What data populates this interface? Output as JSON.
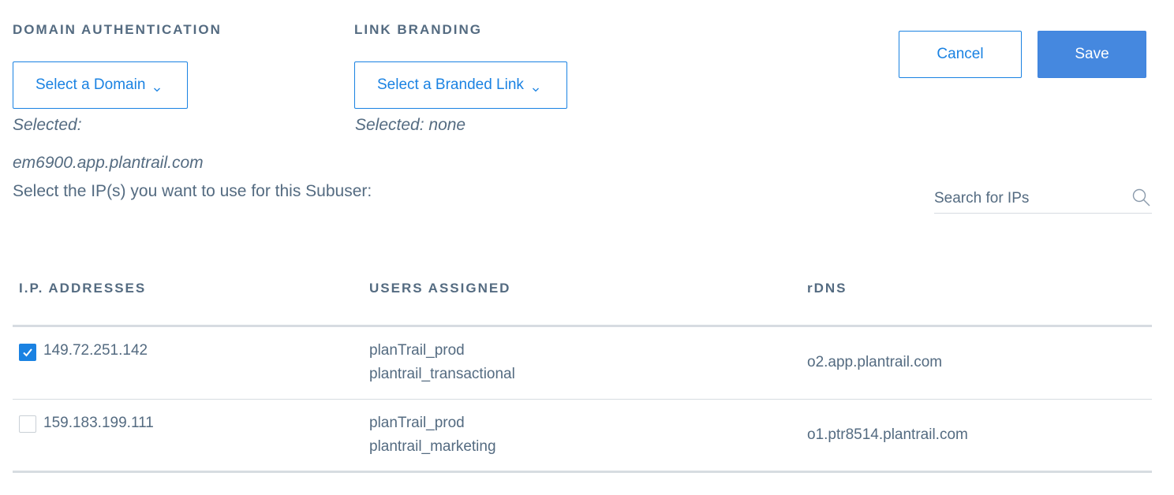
{
  "domain_auth": {
    "label": "DOMAIN AUTHENTICATION",
    "dropdown_label": "Select a Domain",
    "selected_label": "Selected:",
    "selected_value": "em6900.app.plantrail.com"
  },
  "link_branding": {
    "label": "LINK BRANDING",
    "dropdown_label": "Select a Branded Link",
    "selected_text": "Selected: none"
  },
  "actions": {
    "cancel_label": "Cancel",
    "save_label": "Save"
  },
  "ip_select": {
    "prompt": "Select the IP(s) you want to use for this Subuser:",
    "search_placeholder": "Search for IPs"
  },
  "table": {
    "headers": [
      "I.P. ADDRESSES",
      "USERS ASSIGNED",
      "rDNS"
    ],
    "rows": [
      {
        "ip": "149.72.251.142",
        "checked": true,
        "users": [
          "planTrail_prod",
          "plantrail_transactional"
        ],
        "rdns": "o2.app.plantrail.com"
      },
      {
        "ip": "159.183.199.111",
        "checked": false,
        "users": [
          "planTrail_prod",
          "plantrail_marketing"
        ],
        "rdns": "o1.ptr8514.plantrail.com"
      }
    ]
  },
  "colors": {
    "accent": "#1a82e2",
    "save_bg": "#4588df",
    "text": "#546b81",
    "rule": "#d7dce1"
  },
  "icons": {
    "dropdown": "chevron-down-icon",
    "search": "search-icon",
    "check": "checkmark-icon"
  }
}
